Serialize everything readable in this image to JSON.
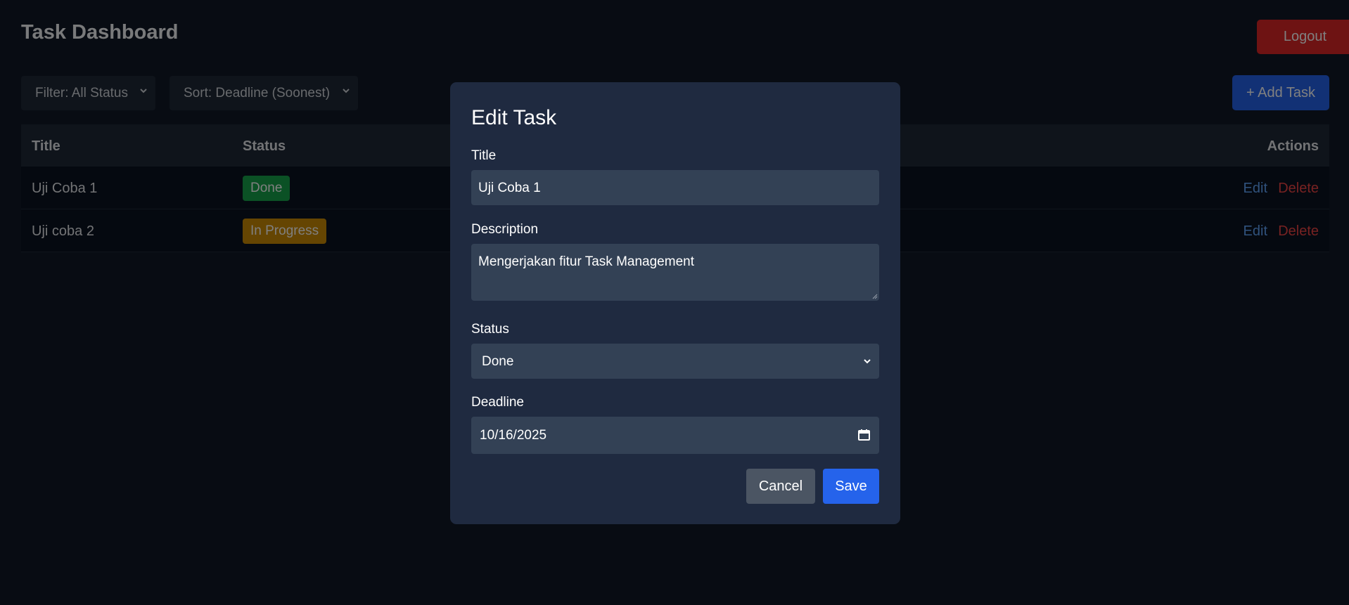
{
  "header": {
    "title": "Task Dashboard",
    "logout_label": "Logout"
  },
  "toolbar": {
    "filter_value": "Filter: All Status",
    "sort_value": "Sort: Deadline (Soonest)",
    "add_label": "+ Add Task"
  },
  "table": {
    "headers": {
      "title": "Title",
      "status": "Status",
      "actions": "Actions"
    },
    "rows": [
      {
        "title": "Uji Coba 1",
        "status": "Done",
        "edit": "Edit",
        "delete": "Delete"
      },
      {
        "title": "Uji coba 2",
        "status": "In Progress",
        "edit": "Edit",
        "delete": "Delete"
      }
    ]
  },
  "modal": {
    "heading": "Edit Task",
    "title_label": "Title",
    "title_value": "Uji Coba 1",
    "description_label": "Description",
    "description_value": "Mengerjakan fitur Task Management",
    "status_label": "Status",
    "status_value": "Done",
    "deadline_label": "Deadline",
    "deadline_value": "10/16/2025",
    "cancel_label": "Cancel",
    "save_label": "Save"
  },
  "colors": {
    "background": "#111827",
    "primary": "#2563eb",
    "danger": "#dc2626",
    "success": "#16a34a",
    "warning": "#ca8a04",
    "modal": "#1f2a40"
  }
}
